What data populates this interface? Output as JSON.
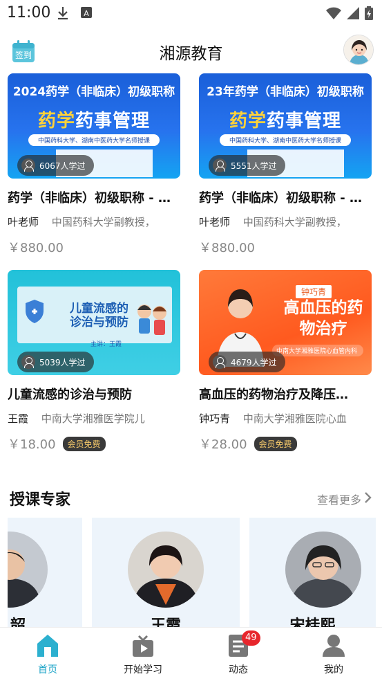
{
  "status_bar": {
    "time": "11:00"
  },
  "header": {
    "title": "湘源教育",
    "checkin_label": "签到"
  },
  "courses": [
    {
      "banner_line1": "2024药学（非临床）初级职称",
      "banner_line2_highlight": "药学",
      "banner_line2_rest": "药事管理",
      "banner_line3": "中国药科大学、湖南中医药大学名师授课",
      "learners": "6067人学过",
      "title": "药学（非临床）初级职称 - …",
      "teacher": "叶老师",
      "teacher_desc": "中国药科大学副教授，",
      "price": "￥880.00",
      "vip": ""
    },
    {
      "banner_line1": "23年药学（非临床）初级职称",
      "banner_line2_highlight": "药学",
      "banner_line2_rest": "药事管理",
      "banner_line3": "中国药科大学、湖南中医药大学名师授课",
      "learners": "5551人学过",
      "title": "药学（非临床）初级职称 - …",
      "teacher": "叶老师",
      "teacher_desc": "中国药科大学副教授，",
      "price": "￥880.00",
      "vip": ""
    },
    {
      "banner_line1": "儿童流感的",
      "banner_line2_highlight": "",
      "banner_line2_rest": "诊治与预防",
      "banner_line3": "主讲：王霞",
      "learners": "5039人学过",
      "title": "儿童流感的诊治与预防",
      "teacher": "王霞",
      "teacher_desc": "中南大学湘雅医学院儿",
      "price": "￥18.00",
      "vip": "会员免费"
    },
    {
      "banner_line1": "钟巧青",
      "banner_line2_highlight": "",
      "banner_line2_rest": "高血压的药物治疗",
      "banner_line3": "中南大学湘雅医院心血管内科",
      "learners": "4679人学过",
      "title": "高血压的药物治疗及降压…",
      "teacher": "钟巧青",
      "teacher_desc": "中南大学湘雅医院心血",
      "price": "￥28.00",
      "vip": "会员免费"
    }
  ],
  "experts": {
    "title": "授课专家",
    "see_more": "查看更多",
    "names": [
      "韶",
      "王霞",
      "宋桂熙"
    ]
  },
  "bottom_nav": {
    "items": [
      "首页",
      "开始学习",
      "动态",
      "我的"
    ],
    "badge": "49"
  },
  "colors": {
    "accent": "#1aa3c7",
    "badge": "#e7262c"
  }
}
